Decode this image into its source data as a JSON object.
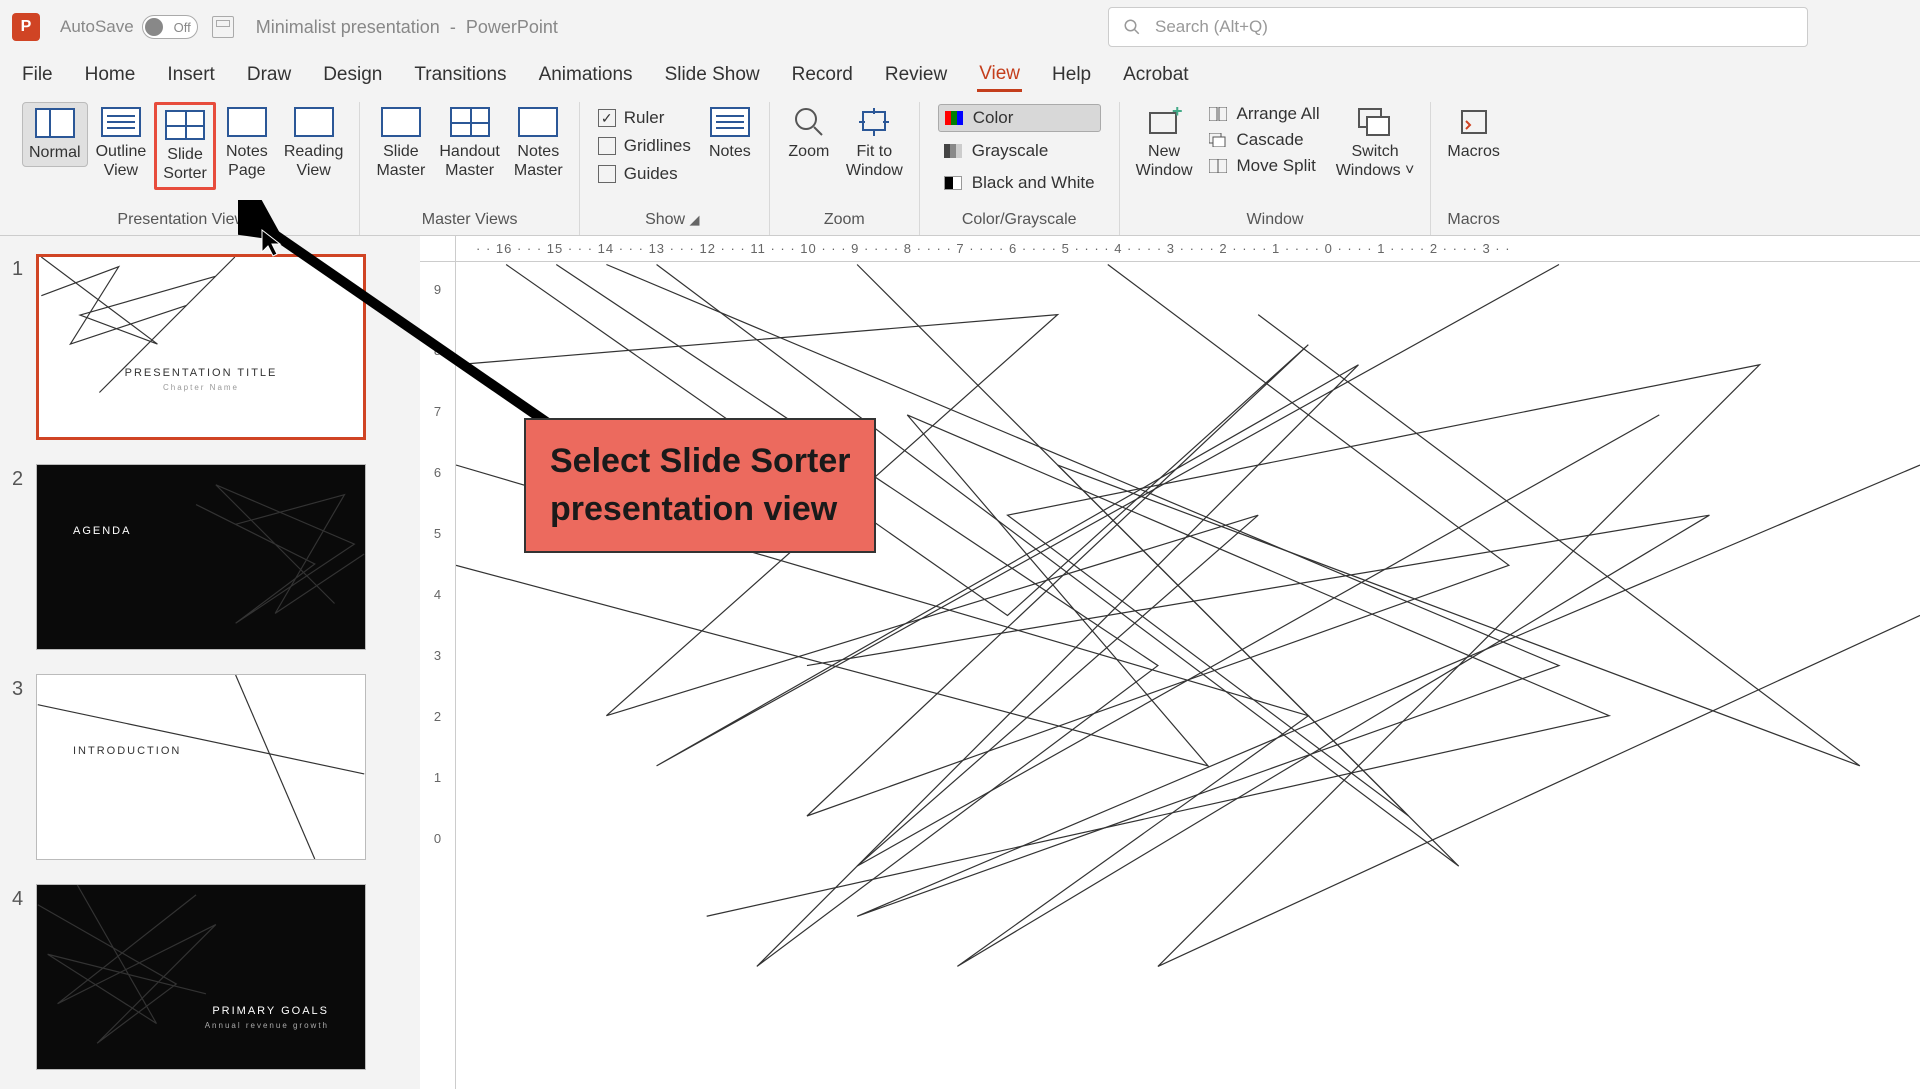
{
  "title_bar": {
    "autosave": "AutoSave",
    "toggle": "Off",
    "doc_name": "Minimalist presentation",
    "app_name": "PowerPoint",
    "search_placeholder": "Search (Alt+Q)"
  },
  "tabs": {
    "file": "File",
    "home": "Home",
    "insert": "Insert",
    "draw": "Draw",
    "design": "Design",
    "transitions": "Transitions",
    "animations": "Animations",
    "slideshow": "Slide Show",
    "record": "Record",
    "review": "Review",
    "view": "View",
    "help": "Help",
    "acrobat": "Acrobat"
  },
  "ribbon": {
    "presentation_views": {
      "label": "Presentation Views",
      "normal": "Normal",
      "outline": "Outline\nView",
      "sorter": "Slide\nSorter",
      "notes": "Notes\nPage",
      "reading": "Reading\nView"
    },
    "master_views": {
      "label": "Master Views",
      "slide": "Slide\nMaster",
      "handout": "Handout\nMaster",
      "notes": "Notes\nMaster"
    },
    "show": {
      "label": "Show",
      "ruler": "Ruler",
      "gridlines": "Gridlines",
      "guides": "Guides",
      "notes": "Notes"
    },
    "zoom": {
      "label": "Zoom",
      "zoom": "Zoom",
      "fit": "Fit to\nWindow"
    },
    "color": {
      "label": "Color/Grayscale",
      "color": "Color",
      "grayscale": "Grayscale",
      "bw": "Black and White"
    },
    "window": {
      "label": "Window",
      "new": "New\nWindow",
      "arrange": "Arrange All",
      "cascade": "Cascade",
      "split": "Move Split",
      "switch": "Switch\nWindows"
    },
    "macros": {
      "label": "Macros",
      "macros": "Macros"
    }
  },
  "ruler_h": "· · 16 · · · 15 · · · 14 · · · 13 · · · 12 · · · 11 · · · 10 · · · 9 · · · · 8 · · · · 7 · · · · 6 · · · · 5 · · · · 4 · · · · 3 · · · · 2 · · · · 1 · · · · 0 · · · · 1 · · · · 2 · · · · 3 · ·",
  "ruler_v": [
    "9",
    "8",
    "7",
    "6",
    "5",
    "4",
    "3",
    "2",
    "1",
    "0"
  ],
  "thumbnails": {
    "s1": {
      "num": "1",
      "title": "PRESENTATION TITLE",
      "sub": "Chapter Name"
    },
    "s2": {
      "num": "2",
      "title": "AGENDA"
    },
    "s3": {
      "num": "3",
      "title": "INTRODUCTION"
    },
    "s4": {
      "num": "4",
      "title": "PRIMARY GOALS",
      "sub": "Annual revenue growth"
    }
  },
  "callout": {
    "line1": "Select Slide Sorter",
    "line2": "presentation view"
  }
}
